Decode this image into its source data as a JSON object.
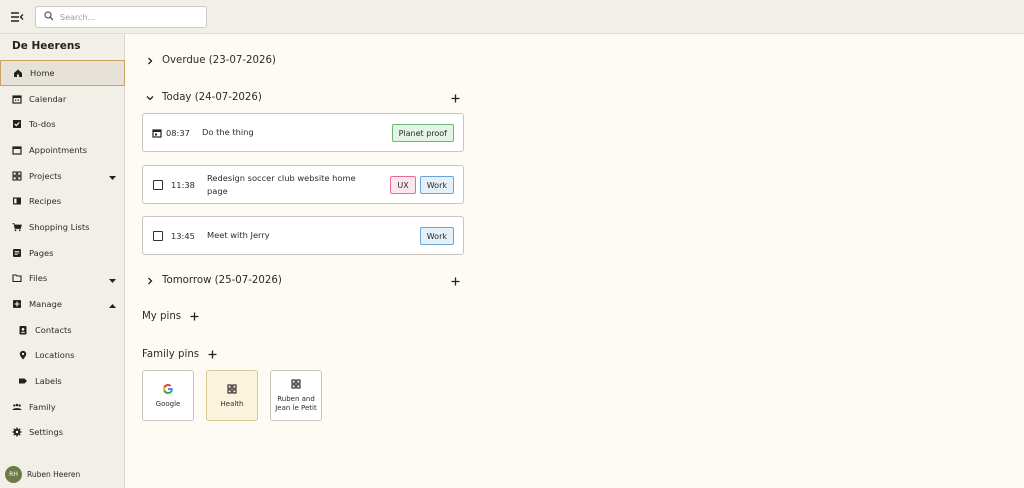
{
  "search": {
    "placeholder": "Search..."
  },
  "sidebar": {
    "brand": "De Heerens",
    "items": [
      {
        "label": "Home",
        "icon": "home-icon"
      },
      {
        "label": "Calendar",
        "icon": "calendar-icon"
      },
      {
        "label": "To-dos",
        "icon": "checkbox-icon"
      },
      {
        "label": "Appointments",
        "icon": "calendar-blank-icon"
      },
      {
        "label": "Projects",
        "icon": "grid-icon"
      },
      {
        "label": "Recipes",
        "icon": "book-icon"
      },
      {
        "label": "Shopping Lists",
        "icon": "cart-icon"
      },
      {
        "label": "Pages",
        "icon": "page-icon"
      },
      {
        "label": "Files",
        "icon": "folder-icon"
      },
      {
        "label": "Manage",
        "icon": "manage-icon"
      },
      {
        "label": "Contacts",
        "icon": "contacts-icon"
      },
      {
        "label": "Locations",
        "icon": "location-pin-icon"
      },
      {
        "label": "Labels",
        "icon": "label-icon"
      },
      {
        "label": "Family",
        "icon": "family-icon"
      },
      {
        "label": "Settings",
        "icon": "gear-icon"
      }
    ],
    "user": {
      "initials": "RH",
      "name": "Ruben Heeren"
    }
  },
  "main": {
    "overdue": "Overdue (23-07-2026)",
    "today": "Today (24-07-2026)",
    "tomorrow": "Tomorrow (25-07-2026)",
    "events": [
      {
        "time": "08:37",
        "title": "Do the thing",
        "tags": [
          "Planet proof"
        ]
      },
      {
        "time": "11:38",
        "title": "Redesign soccer club website home page",
        "tags": [
          "UX",
          "Work"
        ]
      },
      {
        "time": "13:45",
        "title": "Meet with Jerry",
        "tags": [
          "Work"
        ]
      }
    ],
    "my_pins": "My pins",
    "family_pins": "Family pins",
    "pins": [
      {
        "label": "Google",
        "icon": "google-icon"
      },
      {
        "label": "Health",
        "icon": "grid-icon"
      },
      {
        "label": "Ruben and Jean le Petit",
        "icon": "grid-icon"
      }
    ]
  },
  "colors": {
    "sidebar_bg": "#f2efe9",
    "main_bg": "#fdfbf3",
    "active_border": "#c9a25e",
    "tag_green": "#6bb67a",
    "tag_pink": "#e86b98",
    "tag_blue": "#6aa4d6",
    "avatar": "#6b7a47"
  }
}
